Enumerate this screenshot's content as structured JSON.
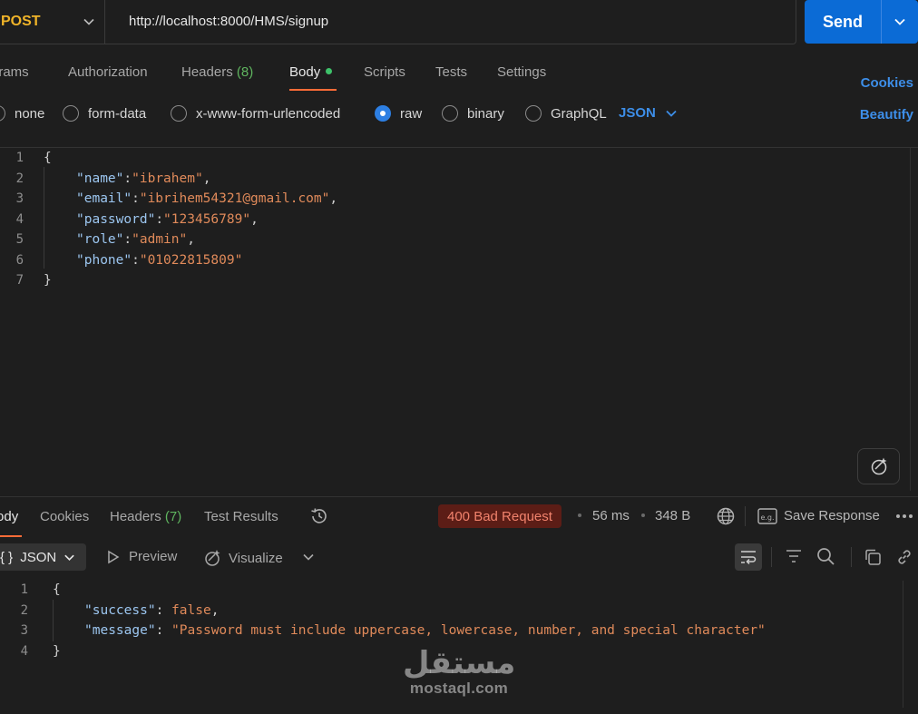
{
  "request": {
    "method": "POST",
    "url": "http://localhost:8000/HMS/signup",
    "send_label": "Send"
  },
  "request_tabs": [
    {
      "label": "Params"
    },
    {
      "label": "Authorization"
    },
    {
      "label": "Headers",
      "count": "(8)"
    },
    {
      "label": "Body"
    },
    {
      "label": "Scripts"
    },
    {
      "label": "Tests"
    },
    {
      "label": "Settings"
    }
  ],
  "request_links": {
    "cookies": "Cookies",
    "beautify": "Beautify"
  },
  "body_types": [
    {
      "label": "none"
    },
    {
      "label": "form-data"
    },
    {
      "label": "x-www-form-urlencoded"
    },
    {
      "label": "raw",
      "selected": true
    },
    {
      "label": "binary"
    },
    {
      "label": "GraphQL"
    }
  ],
  "raw_format": "JSON",
  "request_body": {
    "line_numbers": [
      "1",
      "2",
      "3",
      "4",
      "5",
      "6",
      "7"
    ],
    "open_brace": "{",
    "close_brace": "}",
    "fields": [
      {
        "key": "\"name\"",
        "sep": ":",
        "value": "\"ibrahem\"",
        "trail": ","
      },
      {
        "key": "\"email\"",
        "sep": ":",
        "value": "\"ibrihem54321@gmail.com\"",
        "trail": ","
      },
      {
        "key": "\"password\"",
        "sep": ":",
        "value": "\"123456789\"",
        "trail": ","
      },
      {
        "key": "\"role\"",
        "sep": ":",
        "value": "\"admin\"",
        "trail": ","
      },
      {
        "key": "\"phone\"",
        "sep": ":",
        "value": "\"01022815809\"",
        "trail": ""
      }
    ]
  },
  "response_tabs": [
    {
      "label": "Body"
    },
    {
      "label": "Cookies"
    },
    {
      "label": "Headers",
      "count": "(7)"
    },
    {
      "label": "Test Results"
    }
  ],
  "response_meta": {
    "status": "400 Bad Request",
    "time": "56 ms",
    "size": "348 B",
    "save_label": "Save Response"
  },
  "response_toolbar": {
    "format_label": "JSON",
    "format_prefix": "{ }",
    "preview_label": "Preview",
    "visualize_label": "Visualize"
  },
  "response_body": {
    "line_numbers": [
      "1",
      "2",
      "3",
      "4"
    ],
    "open_brace": "{",
    "close_brace": "}",
    "fields": [
      {
        "key": "\"success\"",
        "sep": ": ",
        "value": "false",
        "trail": ","
      },
      {
        "key": "\"message\"",
        "sep": ": ",
        "value": "\"Password must include uppercase, lowercase, number, and special character\"",
        "trail": ""
      }
    ]
  },
  "watermark": {
    "arabic": "مستقل",
    "latin": "mostaql.com"
  },
  "colors": {
    "accent_orange": "#ff6c37",
    "send_blue": "#0b6bd6",
    "method_yellow": "#f0b429",
    "error_red": "#f0826c"
  }
}
